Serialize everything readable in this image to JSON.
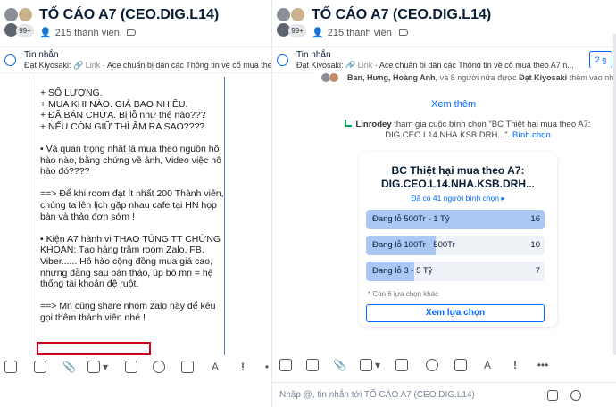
{
  "left": {
    "header": {
      "title": "TỐ CÁO A7 (CEO.DIG.L14)",
      "member_badge": "99+",
      "members": "215 thành viên"
    },
    "pinned": {
      "label": "Tin nhắn",
      "sender": "Đạt Kiyosaki:",
      "link_label": "Link",
      "text": "· Ace chuẩn bị dần các Thông tin về cổ mua theo A7 n..."
    },
    "message_lines": [
      "+ SỐ LƯỢNG.",
      "+ MUA KHI NÀO. GIÁ BAO NHIÊU.",
      "+ ĐÃ BÁN CHƯA. Bị lỗ như thế nào???",
      "+ NẾU CÒN GIỮ THÌ ÂM RA SAO????",
      "",
      "• Và quan trọng nhất là mua theo nguồn hô",
      "hào nào, bằng chứng về ảnh, Video việc hô",
      "hào đó????",
      "",
      "==> Để khi room đạt ít nhất 200 Thành viên,",
      "chúng ta lên lịch gặp nhau cafe tại HN họp",
      "bàn và thảo đơn sớm !",
      "",
      "• Kiện A7 hành vi THAO TÚNG TT CHỨNG",
      "KHOÁN: Tạo hàng trăm room Zalo, FB,",
      "Viber...... Hô hào cộng đồng mua giá cao,",
      "nhưng đằng sau bán tháo, úp bô mn = hệ",
      "thống tài khoản đệ ruột.",
      "",
      "==> Mn cũng share nhóm zalo này để kêu",
      "gọi thêm thành viên nhé !"
    ]
  },
  "right": {
    "header": {
      "title": "TỐ CÁO A7 (CEO.DIG.L14)",
      "member_badge": "99+",
      "members": "215 thành viên"
    },
    "pinned": {
      "label": "Tin nhắn",
      "sender": "Đạt Kiyosaki:",
      "link_label": "Link",
      "text": "· Ace chuẩn bị dần các Thông tin về cổ mua theo A7 n...",
      "button": "2 g"
    },
    "seen": {
      "names": "Ban, Hưng, Hoàng Anh,",
      "rest": "và 8 người nữa được",
      "actor": "Đạt Kiyosaki",
      "tail": "thêm vào nhó"
    },
    "more_button": "Xem thêm",
    "poll_notice": {
      "actor": "Linrodey",
      "text": "tham gia cuộc bình chọn \"BC Thiệt hại mua theo A7:",
      "line2": "DIG.CEO.L14.NHA.KSB.DRH...\".",
      "link": "Bình chọn"
    },
    "poll": {
      "title_line1": "BC Thiệt hại mua theo A7:",
      "title_line2": "DIG.CEO.L14.NHA.KSB.DRH...",
      "voted": "Đã có 41 người bình chọn ▸",
      "options": [
        {
          "label": "Đang lỗ 500Tr - 1 Tỷ",
          "count": "16",
          "fraction": 1.0
        },
        {
          "label": "Đang lỗ 100Tr - 500Tr",
          "count": "10",
          "fraction": 0.625
        },
        {
          "label": "Đang lỗ 3 - 5 Tỷ",
          "count": "7",
          "fraction": 0.4375
        }
      ],
      "note": "* Còn 6 lựa chọn khác",
      "button": "Xem lựa chọn"
    },
    "input_placeholder": "Nhập @, tin nhắn tới TỐ CÁO A7 (CEO.DIG.L14)"
  },
  "colors": {
    "accent": "#0068ff",
    "highlight_box": "#d0021b",
    "poll_fill": "#a9c8f4"
  }
}
